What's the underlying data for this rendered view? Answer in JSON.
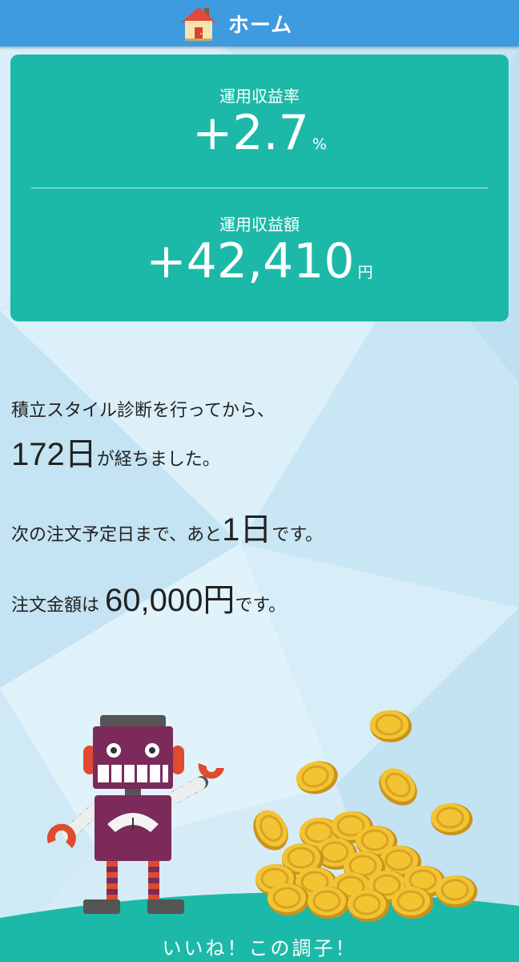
{
  "header": {
    "title": "ホーム",
    "icon": "house-icon"
  },
  "summary": {
    "rate_label": "運用収益率",
    "rate_value": "+2.7",
    "rate_unit": "%",
    "amount_label": "運用収益額",
    "amount_value": "+42,410",
    "amount_unit": "円"
  },
  "info": {
    "line1": "積立スタイル診断を行ってから、",
    "days_value": "172日",
    "days_suffix": "が経ちました。",
    "next_prefix": "次の注文予定日まで、あと",
    "next_value": "1日",
    "next_suffix": "です。",
    "order_prefix": "注文金額は",
    "order_value": "60,000円",
    "order_suffix": "です。"
  },
  "footer": {
    "message": "いいね！この調子！"
  },
  "colors": {
    "header": "#3e9be0",
    "accent": "#1db9a8",
    "background": "#cfe9f6",
    "robot": "#7b2a5a",
    "coin": "#f2c230"
  }
}
